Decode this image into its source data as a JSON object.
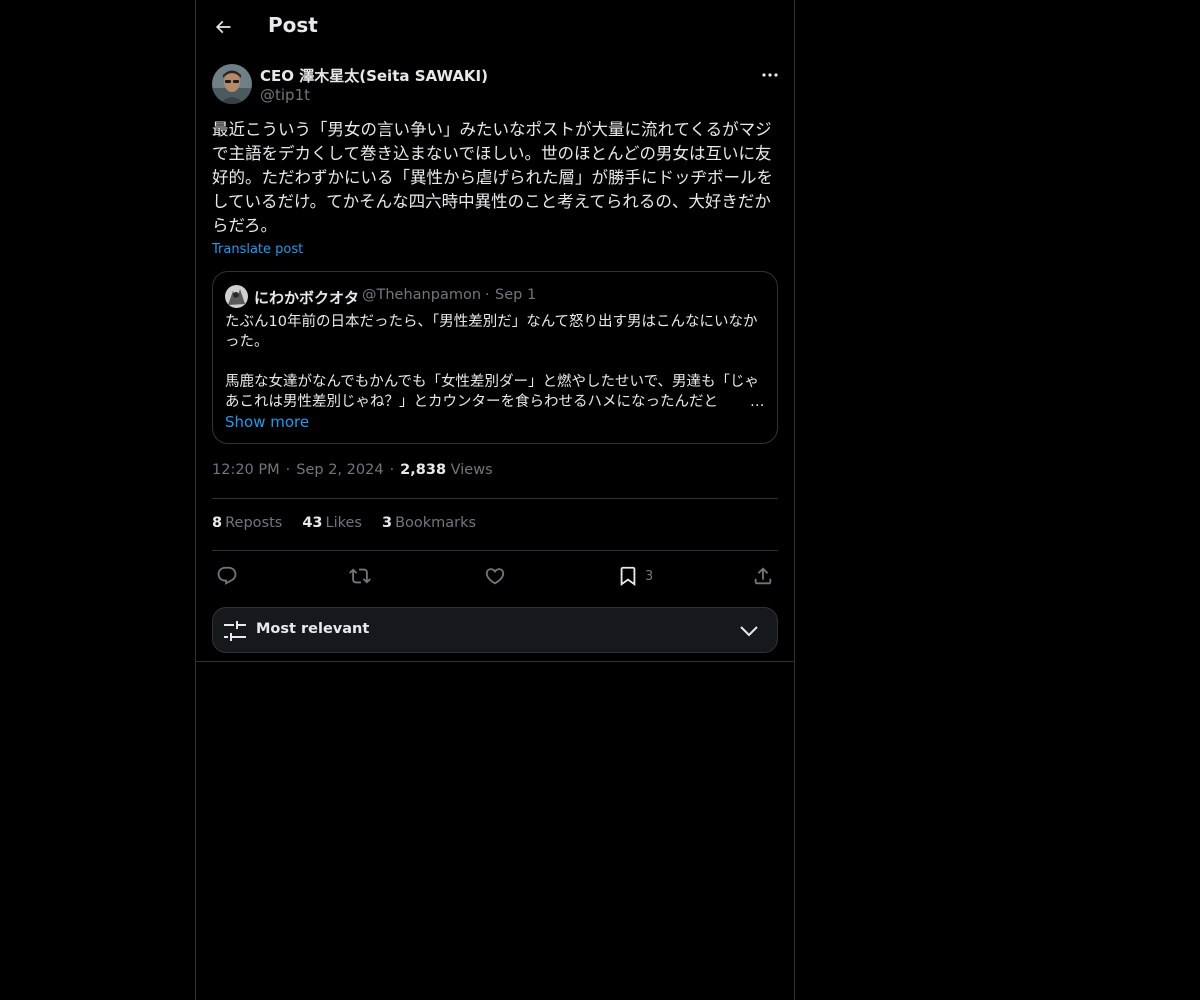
{
  "header": {
    "title": "Post"
  },
  "post": {
    "author": {
      "name": "CEO 澤木星太(Seita SAWAKI)",
      "handle": "@tip1t"
    },
    "text": "最近こういう「男女の言い争い」みたいなポストが大量に流れてくるがマジで主語をデカくして巻き込まないでほしい。世のほとんどの男女は互いに友好的。ただわずかにいる「異性から虐げられた層」が勝手にドッヂボールをしているだけ。てかそんな四六時中異性のこと考えてられるの、大好きだからだろ。",
    "translate_label": "Translate post",
    "quote": {
      "name": "にわかボクオタ",
      "handle": "@Thehanpamon",
      "separator": "·",
      "date": "Sep 1",
      "text": "たぶん10年前の日本だったら、「男性差別だ」なんて怒り出す男はこんなにいなかった。\n\n馬鹿な女達がなんでもかんでも「女性差別ダー」と燃やしたせいで、男達も「じゃあこれは男性差別じゃね？」とカウンターを食らわせるハメになったんだと",
      "ellipsis": "…",
      "show_more": "Show more"
    },
    "time": "12:20 PM",
    "date": "Sep 2, 2024",
    "separator": "·",
    "views_count": "2,838",
    "views_label": "Views",
    "stats": {
      "reposts_count": "8",
      "reposts_label": "Reposts",
      "likes_count": "43",
      "likes_label": "Likes",
      "bookmarks_count": "3",
      "bookmarks_label": "Bookmarks"
    },
    "actions": {
      "bookmark_count": "3"
    }
  },
  "sort": {
    "label": "Most relevant"
  },
  "icons": {
    "back": "back-arrow-icon",
    "more": "more-dots-icon",
    "reply": "reply-icon",
    "repost": "repost-icon",
    "like": "heart-icon",
    "bookmark": "bookmark-icon",
    "share": "share-icon",
    "sort": "sliders-icon",
    "chevron": "chevron-down-icon"
  },
  "colors": {
    "accent": "#1d9bf0",
    "muted": "#71767b",
    "border": "#2f3336",
    "text": "#e7e9ea",
    "background": "#000000"
  }
}
